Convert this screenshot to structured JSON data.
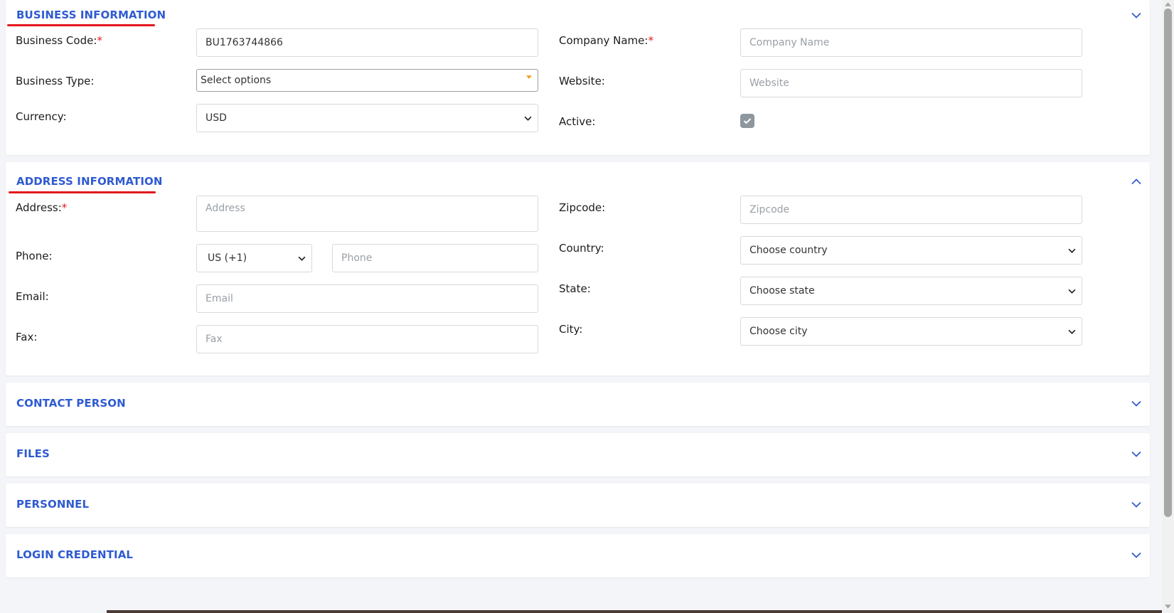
{
  "sections": {
    "business": {
      "title": "BUSINESS INFORMATION",
      "business_code_label": "Business Code:",
      "business_code_value": "BU1763744866",
      "business_type_label": "Business Type:",
      "business_type_value": "Select options",
      "currency_label": "Currency:",
      "currency_value": "USD",
      "company_name_label": "Company Name:",
      "company_name_placeholder": "Company Name",
      "website_label": "Website:",
      "website_placeholder": "Website",
      "active_label": "Active:",
      "active_checked": true
    },
    "address": {
      "title": "ADDRESS INFORMATION",
      "address_label": "Address:",
      "address_placeholder": "Address",
      "phone_label": "Phone:",
      "phone_code_value": "US (+1)",
      "phone_placeholder": "Phone",
      "email_label": "Email:",
      "email_placeholder": "Email",
      "fax_label": "Fax:",
      "fax_placeholder": "Fax",
      "zipcode_label": "Zipcode:",
      "zipcode_placeholder": "Zipcode",
      "country_label": "Country:",
      "country_value": "Choose country",
      "state_label": "State:",
      "state_value": "Choose state",
      "city_label": "City:",
      "city_value": "Choose city"
    },
    "contact_person": {
      "title": "CONTACT PERSON"
    },
    "files": {
      "title": "FILES"
    },
    "personnel": {
      "title": "PERSONNEL"
    },
    "login_credential": {
      "title": "LOGIN CREDENTIAL"
    }
  },
  "required_marker": "*",
  "colors": {
    "section_title": "#2f5bd1",
    "underline": "#e3171d",
    "required": "#e3171d",
    "checkbox": "#8e969e",
    "select_arrow_accent": "#f0a020"
  },
  "icons": {
    "collapse": "chevron-down-icon",
    "expand": "chevron-up-icon",
    "dropdown": "caret-down-icon",
    "check": "check-icon"
  }
}
